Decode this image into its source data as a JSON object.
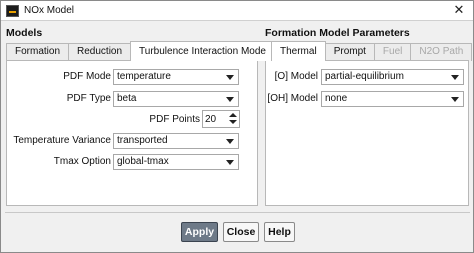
{
  "window": {
    "title": "NOx Model",
    "close_glyph": "✕"
  },
  "models": {
    "section_title": "Models",
    "tabs": [
      {
        "label": "Formation",
        "active": false
      },
      {
        "label": "Reduction",
        "active": false
      },
      {
        "label": "Turbulence Interaction Mode",
        "active": true
      }
    ],
    "fields": {
      "pdf_mode": {
        "label": "PDF Mode",
        "value": "temperature"
      },
      "pdf_type": {
        "label": "PDF Type",
        "value": "beta"
      },
      "pdf_points": {
        "label": "PDF Points",
        "value": "20"
      },
      "temperature_variance": {
        "label": "Temperature Variance",
        "value": "transported"
      },
      "tmax_option": {
        "label": "Tmax Option",
        "value": "global-tmax"
      }
    }
  },
  "formation_params": {
    "section_title": "Formation Model Parameters",
    "tabs": [
      {
        "label": "Thermal",
        "active": true,
        "enabled": true
      },
      {
        "label": "Prompt",
        "active": false,
        "enabled": true
      },
      {
        "label": "Fuel",
        "active": false,
        "enabled": false
      },
      {
        "label": "N2O Path",
        "active": false,
        "enabled": false
      }
    ],
    "fields": {
      "o_model": {
        "label": "[O] Model",
        "value": "partial-equilibrium"
      },
      "oh_model": {
        "label": "[OH] Model",
        "value": "none"
      }
    }
  },
  "buttons": {
    "apply": "Apply",
    "close": "Close",
    "help": "Help"
  },
  "icons": {
    "app": "nox-model-app-icon",
    "close": "close-icon",
    "dropdown": "chevron-down-icon"
  },
  "colors": {
    "primary_button": "#6e7a88",
    "panel_bg": "#ffffff",
    "dialog_bg": "#f0f0f0"
  }
}
